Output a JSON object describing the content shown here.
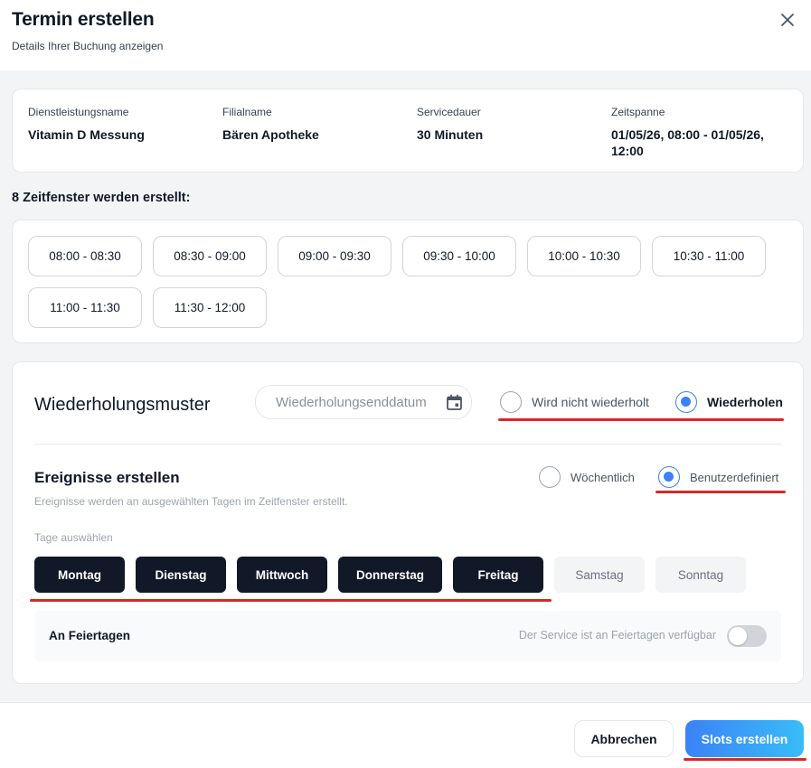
{
  "header": {
    "title": "Termin erstellen",
    "subtitle": "Details Ihrer Buchung anzeigen",
    "close_icon": "close-icon"
  },
  "info": [
    {
      "label": "Dienstleistungsname",
      "value": "Vitamin D Messung"
    },
    {
      "label": "Filialname",
      "value": "Bären Apotheke"
    },
    {
      "label": "Servicedauer",
      "value": "30 Minuten"
    },
    {
      "label": "Zeitspanne",
      "value": "01/05/26, 08:00 - 01/05/26, 12:00"
    }
  ],
  "slots": {
    "heading": "8 Zeitfenster werden erstellt:",
    "items": [
      "08:00 - 08:30",
      "08:30 - 09:00",
      "09:00 - 09:30",
      "09:30 - 10:00",
      "10:00 - 10:30",
      "10:30 - 11:00",
      "11:00 - 11:30",
      "11:30 - 12:00"
    ]
  },
  "repeat": {
    "title": "Wiederholungsmuster",
    "end_date_placeholder": "Wiederholungsenddatum",
    "calendar_icon": "calendar-icon",
    "options": [
      {
        "label": "Wird nicht wiederholt",
        "checked": false
      },
      {
        "label": "Wiederholen",
        "checked": true
      }
    ]
  },
  "events": {
    "title": "Ereignisse erstellen",
    "description": "Ereignisse werden an ausgewählten Tagen im Zeitfenster erstellt.",
    "modes": [
      {
        "label": "Wöchentlich",
        "checked": false
      },
      {
        "label": "Benutzerdefiniert",
        "checked": true
      }
    ],
    "days_label": "Tage auswählen",
    "days": [
      {
        "label": "Montag",
        "selected": true
      },
      {
        "label": "Dienstag",
        "selected": true
      },
      {
        "label": "Mittwoch",
        "selected": true
      },
      {
        "label": "Donnerstag",
        "selected": true
      },
      {
        "label": "Freitag",
        "selected": true
      },
      {
        "label": "Samstag",
        "selected": false
      },
      {
        "label": "Sonntag",
        "selected": false
      }
    ],
    "holiday": {
      "label": "An Feiertagen",
      "description": "Der Service ist an Feiertagen verfügbar",
      "enabled": false
    }
  },
  "footer": {
    "cancel_label": "Abbrechen",
    "submit_label": "Slots erstellen"
  },
  "colors": {
    "accent": "#3b82f6",
    "annotation": "#dc2626",
    "day_selected": "#111827"
  }
}
